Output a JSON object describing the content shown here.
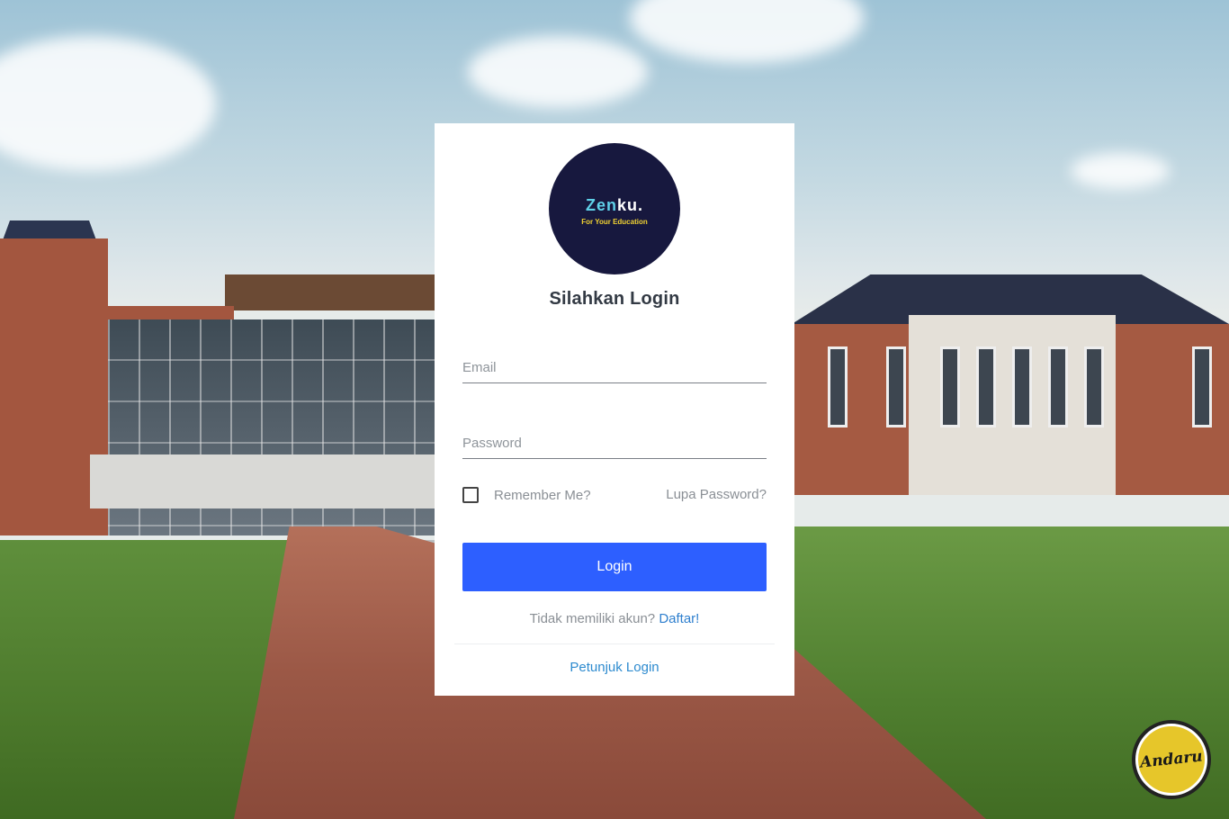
{
  "brand": {
    "name_part1": "Zen",
    "name_part2": "ku.",
    "tagline": "For Your Education"
  },
  "login": {
    "title": "Silahkan Login",
    "email_placeholder": "Email",
    "password_placeholder": "Password",
    "remember_label": "Remember Me?",
    "forgot_label": "Lupa Password?",
    "submit_label": "Login",
    "no_account_text": "Tidak memiliki akun?",
    "register_link": "Daftar!",
    "help_link": "Petunjuk Login"
  },
  "badge": {
    "label": "Andaru"
  },
  "colors": {
    "primary_button": "#2d5fff",
    "link": "#2e7fce",
    "logo_bg": "#17183e"
  }
}
